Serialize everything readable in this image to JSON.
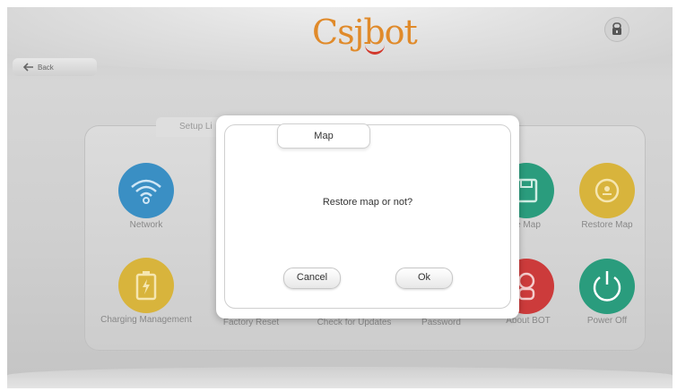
{
  "header": {
    "logo_text": "Csjbot"
  },
  "nav": {
    "back_label": "Back"
  },
  "settings": {
    "tab_label": "Setup Li",
    "tiles": [
      {
        "label": "Network",
        "color": "#3a8fc4",
        "icon": "wifi-icon"
      },
      {
        "label": "e Map",
        "color": "#2a9c7d",
        "icon": "save-map-icon"
      },
      {
        "label": "Restore Map",
        "color": "#d8b43c",
        "icon": "restore-map-icon"
      },
      {
        "label": "Charging Management",
        "color": "#d8b43c",
        "icon": "battery-icon"
      },
      {
        "label": "Factory Reset",
        "icon": "factory-reset-icon"
      },
      {
        "label": "Check for Updates",
        "icon": "update-icon"
      },
      {
        "label": "Password",
        "icon": "password-icon"
      },
      {
        "label": "About BOT",
        "color": "#cc3b3b",
        "icon": "robot-icon"
      },
      {
        "label": "Power Off",
        "color": "#2a9c7d",
        "icon": "power-icon"
      }
    ]
  },
  "dialog": {
    "title": "Map",
    "message": "Restore map or not?",
    "cancel_label": "Cancel",
    "ok_label": "Ok"
  }
}
